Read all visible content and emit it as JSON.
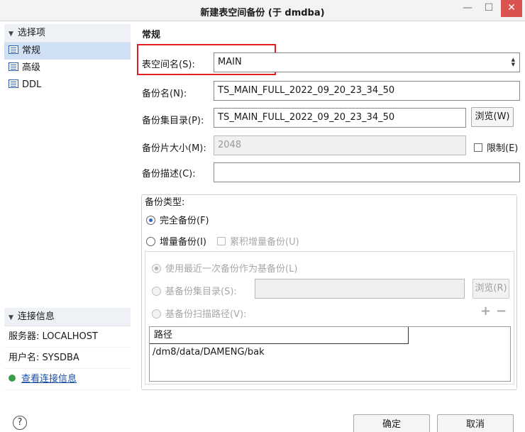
{
  "window": {
    "title": "新建表空间备份 (于 dmdba)",
    "minimize": "—",
    "maximize": "☐",
    "close": "✕"
  },
  "sidebar": {
    "section_title": "选择项",
    "items": [
      {
        "label": "常规",
        "icon": "document-icon",
        "active": true
      },
      {
        "label": "高级",
        "icon": "document-icon",
        "active": false
      },
      {
        "label": "DDL",
        "icon": "document-icon",
        "active": false
      }
    ],
    "connection": {
      "title": "连接信息",
      "server": "服务器: LOCALHOST",
      "user": "用户名: SYSDBA",
      "view_link": "查看连接信息"
    }
  },
  "form": {
    "group_title": "常规",
    "tablespace_label": "表空间名(S):",
    "tablespace_value": "MAIN",
    "backup_name_label": "备份名(N):",
    "backup_name_value": "TS_MAIN_FULL_2022_09_20_23_34_50",
    "backup_dir_label": "备份集目录(P):",
    "backup_dir_value": "TS_MAIN_FULL_2022_09_20_23_34_50",
    "browse_label": "浏览(W)",
    "piece_size_label": "备份片大小(M):",
    "piece_size_value": "2048",
    "limit_label": "限制(E)",
    "desc_label": "备份描述(C):",
    "desc_value": ""
  },
  "backup_type": {
    "legend": "备份类型:",
    "full_label": "完全备份(F)",
    "incremental_label": "增量备份(I)",
    "cumulative_label": "累积增量备份(U)",
    "use_latest_label": "使用最近一次备份作为基备份(L)",
    "base_dir_label": "基备份集目录(S):",
    "base_dir_value": "",
    "browse_r_label": "浏览(R)",
    "scan_path_label": "基备份扫描路径(V):",
    "add_label": "+",
    "remove_label": "−",
    "table_header": "路径",
    "table_rows": [
      "/dm8/data/DAMENG/bak"
    ]
  },
  "footer": {
    "help": "?",
    "ok_label": "确定",
    "cancel_label": "取消"
  },
  "colors": {
    "highlight_border": "#e02020",
    "active_nav": "#cfe0f5",
    "close_button": "#d9534f"
  }
}
